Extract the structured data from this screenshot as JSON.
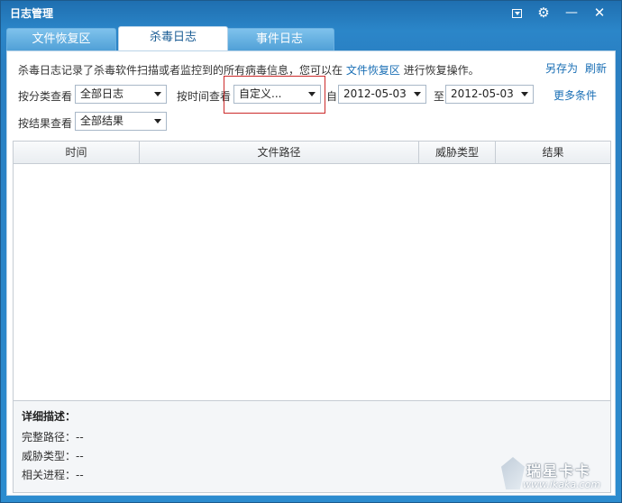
{
  "window": {
    "title": "日志管理"
  },
  "titlebar": {
    "menu_icon": "dropdown-menu-icon",
    "settings_icon": "gear-icon",
    "minimize_icon": "minimize-icon",
    "close_icon": "close-icon",
    "minimize_glyph": "—",
    "close_glyph": "✕",
    "settings_glyph": "⚙"
  },
  "tabs": [
    {
      "label": "文件恢复区",
      "active": false
    },
    {
      "label": "杀毒日志",
      "active": true
    },
    {
      "label": "事件日志",
      "active": false
    }
  ],
  "intro": {
    "text_before": "杀毒日志记录了杀毒软件扫描或者监控到的所有病毒信息，您可以在 ",
    "link": "文件恢复区",
    "text_after": " 进行恢复操作。"
  },
  "actions": {
    "save_as": "另存为",
    "refresh": "刷新",
    "more_conditions": "更多条件"
  },
  "filters": {
    "category_label": "按分类查看",
    "category_value": "全部日志",
    "time_label": "按时间查看",
    "time_value": "自定义...",
    "from_label": "自",
    "from_value": "2012-05-03",
    "to_label": "至",
    "to_value": "2012-05-03",
    "result_label": "按结果查看",
    "result_value": "全部结果"
  },
  "table": {
    "columns": [
      "时间",
      "文件路径",
      "威胁类型",
      "结果"
    ],
    "rows": []
  },
  "detail": {
    "title": "详细描述：",
    "full_path": "完整路径：--",
    "threat_type": "威胁类型：--",
    "process": "相关进程：--"
  },
  "watermark": {
    "title": "瑞星卡卡",
    "url": "www.ikaka.com"
  }
}
